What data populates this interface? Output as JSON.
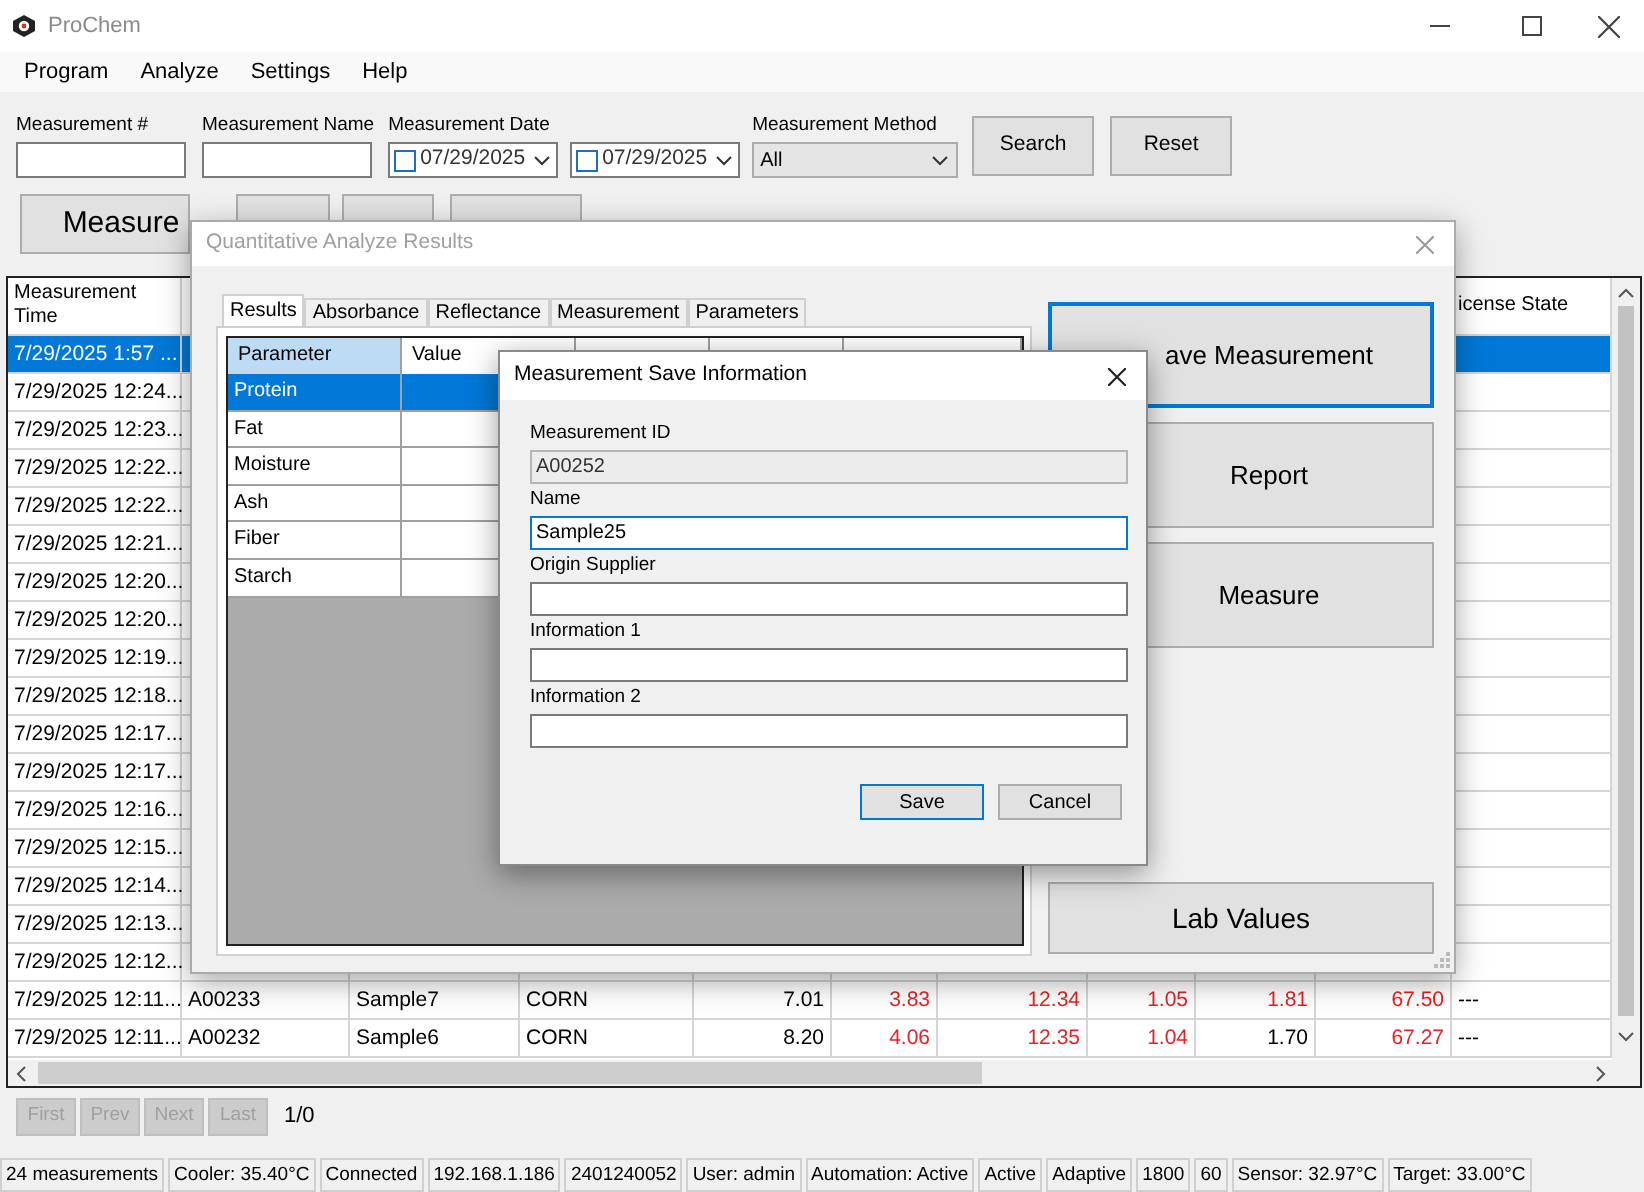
{
  "window": {
    "title": "ProChem"
  },
  "menu": [
    "Program",
    "Analyze",
    "Settings",
    "Help"
  ],
  "filters": {
    "number_label": "Measurement #",
    "name_label": "Measurement Name",
    "date_label": "Measurement Date",
    "dates": [
      {
        "value": "07/29/2025",
        "checked": false
      },
      {
        "value": "07/29/2025",
        "checked": false
      }
    ],
    "method_label": "Measurement Method",
    "method_value": "All",
    "search_button": "Search",
    "reset_button": "Reset"
  },
  "measure_button": "Measure",
  "table": {
    "time_header": "Measurement Time",
    "license_header": "icense State",
    "rows": [
      {
        "selected": true,
        "time": "7/29/2025 1:57 ..."
      },
      {
        "selected": false,
        "time": "7/29/2025 12:24..."
      },
      {
        "selected": false,
        "time": "7/29/2025 12:23..."
      },
      {
        "selected": false,
        "time": "7/29/2025 12:22..."
      },
      {
        "selected": false,
        "time": "7/29/2025 12:22..."
      },
      {
        "selected": false,
        "time": "7/29/2025 12:21..."
      },
      {
        "selected": false,
        "time": "7/29/2025 12:20..."
      },
      {
        "selected": false,
        "time": "7/29/2025 12:20..."
      },
      {
        "selected": false,
        "time": "7/29/2025 12:19..."
      },
      {
        "selected": false,
        "time": "7/29/2025 12:18..."
      },
      {
        "selected": false,
        "time": "7/29/2025 12:17..."
      },
      {
        "selected": false,
        "time": "7/29/2025 12:17..."
      },
      {
        "selected": false,
        "time": "7/29/2025 12:16..."
      },
      {
        "selected": false,
        "time": "7/29/2025 12:15..."
      },
      {
        "selected": false,
        "time": "7/29/2025 12:14..."
      },
      {
        "selected": false,
        "time": "7/29/2025 12:13..."
      },
      {
        "selected": false,
        "time": "7/29/2025 12:12..."
      },
      {
        "selected": false,
        "time": "7/29/2025 12:11...",
        "id": "A00233",
        "name": "Sample7",
        "type": "CORN",
        "values": [
          {
            "text": "7.01",
            "flagged": false
          },
          {
            "text": "3.83",
            "flagged": true
          },
          {
            "text": "12.34",
            "flagged": true
          },
          {
            "text": "1.05",
            "flagged": true
          },
          {
            "text": "1.81",
            "flagged": true
          },
          {
            "text": "67.50",
            "flagged": true
          }
        ],
        "license": "---"
      },
      {
        "selected": false,
        "time": "7/29/2025 12:11...",
        "id": "A00232",
        "name": "Sample6",
        "type": "CORN",
        "values": [
          {
            "text": "8.20",
            "flagged": false
          },
          {
            "text": "4.06",
            "flagged": true
          },
          {
            "text": "12.35",
            "flagged": true
          },
          {
            "text": "1.04",
            "flagged": true
          },
          {
            "text": "1.70",
            "flagged": false
          },
          {
            "text": "67.27",
            "flagged": true
          }
        ],
        "license": "---"
      }
    ]
  },
  "pager": {
    "buttons": [
      {
        "label": "First",
        "disabled": true
      },
      {
        "label": "Prev",
        "disabled": true
      },
      {
        "label": "Next",
        "disabled": true
      },
      {
        "label": "Last",
        "disabled": true
      }
    ],
    "page": "1/0"
  },
  "status_bar": [
    "24 measurements",
    "Cooler: 35.40°C",
    "Connected",
    "192.168.1.186",
    "2401240052",
    "User: admin",
    "Automation: Active",
    "Active",
    "Adaptive",
    "1800",
    "60",
    "Sensor: 32.97°C",
    "Target: 33.00°C"
  ],
  "results_dialog": {
    "title": "Quantitative Analyze Results",
    "tabs": [
      {
        "label": "Results",
        "selected": true
      },
      {
        "label": "Absorbance",
        "selected": false
      },
      {
        "label": "Reflectance",
        "selected": false
      },
      {
        "label": "Measurement",
        "selected": false
      },
      {
        "label": "Parameters",
        "selected": false
      }
    ],
    "columns": [
      "Parameter",
      "Value"
    ],
    "rows": [
      {
        "parameter": "Protein",
        "selected": true
      },
      {
        "parameter": "Fat",
        "selected": false
      },
      {
        "parameter": "Moisture",
        "selected": false
      },
      {
        "parameter": "Ash",
        "selected": false
      },
      {
        "parameter": "Fiber",
        "selected": false
      },
      {
        "parameter": "Starch",
        "selected": false
      }
    ],
    "buttons": [
      {
        "label": "ave Measurement",
        "focused": true
      },
      {
        "label": "Report",
        "focused": false
      },
      {
        "label": "Measure",
        "focused": false
      }
    ],
    "lab_values_button": "Lab Values"
  },
  "save_dialog": {
    "title": "Measurement Save Information",
    "fields": [
      {
        "label": "Measurement ID",
        "value": "A00252",
        "disabled": true,
        "focused": false
      },
      {
        "label": "Name",
        "value": "Sample25",
        "disabled": false,
        "focused": true
      },
      {
        "label": "Origin Supplier",
        "disabled": false,
        "focused": false
      },
      {
        "label": "Information 1",
        "disabled": false,
        "focused": false
      },
      {
        "label": "Information 2",
        "disabled": false,
        "focused": false
      }
    ],
    "buttons": [
      {
        "label": "Save",
        "default": true
      },
      {
        "label": "Cancel",
        "default": false
      }
    ]
  }
}
